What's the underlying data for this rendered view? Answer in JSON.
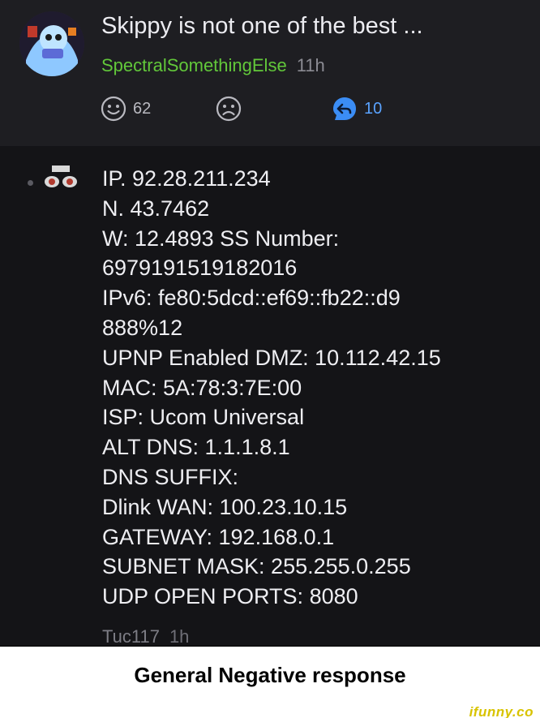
{
  "comment": {
    "text": "Skippy is not one of the best ...",
    "author": "SpectralSomethingElse",
    "time": "11h",
    "actions": {
      "smile_count": "62",
      "reply_count": "10"
    }
  },
  "reply": {
    "lines": [
      "IP. 92.28.211.234",
      "N. 43.7462",
      "W: 12.4893 SS Number:",
      "6979191519182016",
      "IPv6: fe80:5dcd::ef69::fb22::d9",
      "888%12",
      "UPNP Enabled DMZ: 10.112.42.15",
      "MAC: 5A:78:3:7E:00",
      "ISP: Ucom Universal",
      "ALT DNS: 1.1.1.8.1",
      "DNS SUFFIX:",
      "Dlink WAN: 100.23.10.15",
      "GATEWAY: 192.168.0.1",
      "SUBNET MASK: 255.255.0.255",
      "UDP OPEN PORTS: 8080"
    ],
    "author": "Tuc117",
    "time": "1h"
  },
  "caption": "General Negative response",
  "brand": "ifunny.co",
  "colors": {
    "author_green": "#62c83a",
    "reply_blue": "#3b8df5",
    "caption_bg": "#ffffff",
    "brand_yellow": "#d8c300"
  }
}
